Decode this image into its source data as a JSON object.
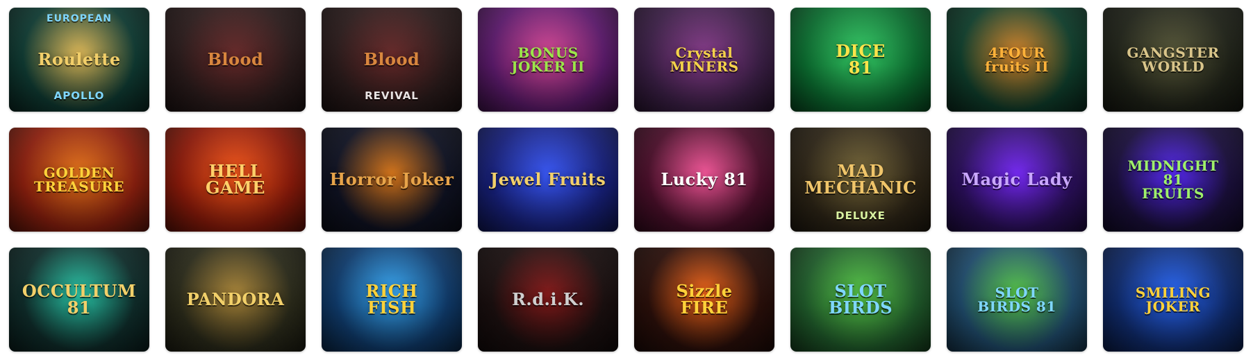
{
  "games": [
    {
      "id": "european-roulette-apollo",
      "kicker": "EUROPEAN",
      "title": "Roulette",
      "subtitle": "APOLLO",
      "bg": "#0f3a32",
      "accent": "#e8c05a",
      "title_color": "#f2cf6a",
      "sub_color": "#7fd7ff"
    },
    {
      "id": "blood",
      "kicker": "",
      "title": "Blood",
      "subtitle": "",
      "bg": "#2a1b1b",
      "accent": "#6b2a2a",
      "title_color": "#d8863e",
      "sub_color": "#cfc9c9"
    },
    {
      "id": "blood-revival",
      "kicker": "",
      "title": "Blood",
      "subtitle": "REVIVAL",
      "bg": "#2a1b1b",
      "accent": "#6b2a2a",
      "title_color": "#d8863e",
      "sub_color": "#e9e4e4"
    },
    {
      "id": "bonus-joker-ii",
      "kicker": "",
      "title": "BONUS\nJOKER II",
      "subtitle": "",
      "bg": "#5b1a6b",
      "accent": "#e04a9a",
      "title_color": "#9ce64a",
      "sub_color": "#ffffff"
    },
    {
      "id": "crystal-miners",
      "kicker": "",
      "title": "Crystal\nMINERS",
      "subtitle": "",
      "bg": "#3b1f46",
      "accent": "#8b3d8f",
      "title_color": "#f4d24a",
      "sub_color": "#ffffff"
    },
    {
      "id": "dice-81",
      "kicker": "",
      "title": "DICE\n81",
      "subtitle": "",
      "bg": "#0b6b2f",
      "accent": "#36d46a",
      "title_color": "#ffe44a",
      "sub_color": "#ffffff"
    },
    {
      "id": "four-fruits-ii",
      "kicker": "",
      "title": "4FOUR\nfruits II",
      "subtitle": "",
      "bg": "#0f3d2b",
      "accent": "#e08a2a",
      "title_color": "#ffb23a",
      "sub_color": "#ffffff"
    },
    {
      "id": "gangster-world",
      "kicker": "",
      "title": "GANGSTER\nWORLD",
      "subtitle": "",
      "bg": "#1f2218",
      "accent": "#5a5a3a",
      "title_color": "#d9c58a",
      "sub_color": "#ffffff"
    },
    {
      "id": "golden-treasure",
      "kicker": "",
      "title": "GOLDEN\nTREASURE",
      "subtitle": "",
      "bg": "#8a1f0e",
      "accent": "#f07a1a",
      "title_color": "#ffd23a",
      "sub_color": "#ffffff"
    },
    {
      "id": "hell-game",
      "kicker": "",
      "title": "HELL\nGAME",
      "subtitle": "",
      "bg": "#8a1a0a",
      "accent": "#ff5a1a",
      "title_color": "#ffd06a",
      "sub_color": "#ffffff"
    },
    {
      "id": "horror-joker",
      "kicker": "",
      "title": "Horror Joker",
      "subtitle": "",
      "bg": "#0f1222",
      "accent": "#e07a1a",
      "title_color": "#e7a44a",
      "sub_color": "#ffffff"
    },
    {
      "id": "jewel-fruits",
      "kicker": "",
      "title": "Jewel Fruits",
      "subtitle": "",
      "bg": "#17207a",
      "accent": "#3a5aff",
      "title_color": "#f2d06a",
      "sub_color": "#ffffff"
    },
    {
      "id": "lucky-81",
      "kicker": "",
      "title": "Lucky 81",
      "subtitle": "",
      "bg": "#4a0f2a",
      "accent": "#ff5aa0",
      "title_color": "#ffffff",
      "sub_color": "#ffffff"
    },
    {
      "id": "mad-mechanic-deluxe",
      "kicker": "",
      "title": "MAD\nMECHANIC",
      "subtitle": "DELUXE",
      "bg": "#2c2416",
      "accent": "#7b6b3a",
      "title_color": "#f0c56a",
      "sub_color": "#d8f0a0"
    },
    {
      "id": "magic-lady",
      "kicker": "",
      "title": "Magic Lady",
      "subtitle": "",
      "bg": "#2a0f5a",
      "accent": "#7a2aff",
      "title_color": "#c9a7ff",
      "sub_color": "#ffffff"
    },
    {
      "id": "midnight-fruits-81",
      "kicker": "",
      "title": "MIDNIGHT\n81\nFRUITS",
      "subtitle": "",
      "bg": "#1a0f3b",
      "accent": "#5a2aff",
      "title_color": "#9ff06a",
      "sub_color": "#ffffff"
    },
    {
      "id": "occultum-81",
      "kicker": "",
      "title": "OCCULTUM\n81",
      "subtitle": "",
      "bg": "#0f2c2a",
      "accent": "#2ad0b0",
      "title_color": "#f2d06a",
      "sub_color": "#ffffff"
    },
    {
      "id": "pandora",
      "kicker": "",
      "title": "PANDORA",
      "subtitle": "",
      "bg": "#2a2a1a",
      "accent": "#b08a3a",
      "title_color": "#f2d06a",
      "sub_color": "#ffffff"
    },
    {
      "id": "rich-fish",
      "kicker": "",
      "title": "RICH\nFISH",
      "subtitle": "",
      "bg": "#0f3a6a",
      "accent": "#3ab0ff",
      "title_color": "#ffd23a",
      "sub_color": "#ffffff"
    },
    {
      "id": "r-d-i-k",
      "kicker": "",
      "title": "R.d.i.K.",
      "subtitle": "",
      "bg": "#1a0f0f",
      "accent": "#8a1a1a",
      "title_color": "#cfcfcf",
      "sub_color": "#ffffff"
    },
    {
      "id": "sizzle-fire",
      "kicker": "",
      "title": "Sizzle\nFIRE",
      "subtitle": "",
      "bg": "#2a0f0a",
      "accent": "#ff6a1a",
      "title_color": "#ffd23a",
      "sub_color": "#ffffff"
    },
    {
      "id": "slot-birds",
      "kicker": "",
      "title": "SLOT\nBIRDS",
      "subtitle": "",
      "bg": "#1f5a2a",
      "accent": "#5ad04a",
      "title_color": "#7fd7ff",
      "sub_color": "#ffffff"
    },
    {
      "id": "slot-birds-81",
      "kicker": "",
      "title": "SLOT\nBIRDS 81",
      "subtitle": "",
      "bg": "#1f4a6a",
      "accent": "#5ad04a",
      "title_color": "#7fd7ff",
      "sub_color": "#ffffff"
    },
    {
      "id": "smiling-joker",
      "kicker": "",
      "title": "SMILING JOKER",
      "subtitle": "",
      "bg": "#0f2a6a",
      "accent": "#2a6aff",
      "title_color": "#ffd23a",
      "sub_color": "#ffffff"
    }
  ]
}
